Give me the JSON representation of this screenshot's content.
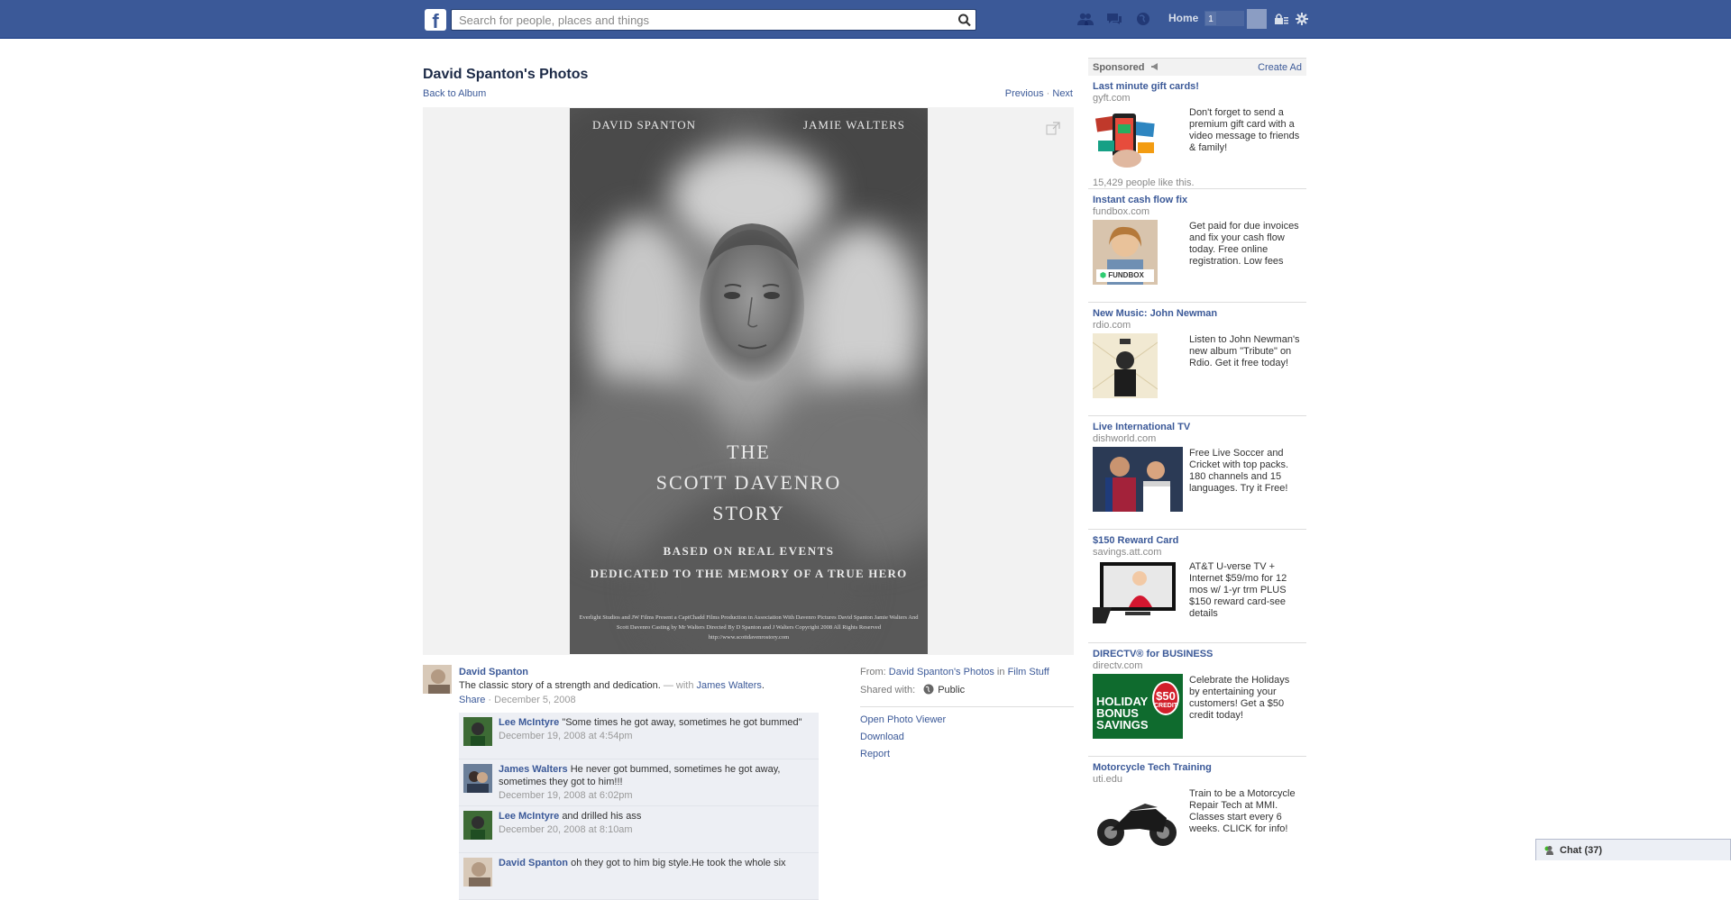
{
  "topbar": {
    "logo": "f",
    "search_placeholder": "Search for people, places and things",
    "home_label": "Home",
    "home_count": "1"
  },
  "page": {
    "title": "David Spanton's Photos",
    "back_link": "Back to Album",
    "previous": "Previous",
    "separator": " · ",
    "next": "Next"
  },
  "poster": {
    "name_left": "DAVID SPANTON",
    "name_right": "JAMIE WALTERS",
    "title": "THE\nSCOTT DAVENRO\nSTORY",
    "subtitle1": "BASED ON REAL EVENTS",
    "subtitle2": "DEDICATED TO THE MEMORY OF A TRUE HERO",
    "credits": "Everlight Studios and JW Films Present a CaptChadd Films Production in Association With Davenro Pictures David Spanton Jamie Walters And Scott Davenro Casting by Mr Walters Directed By D Spanton and J Walters Copyright 2008 All Rights Reserved http://www.scottdavenrostory.com"
  },
  "caption": {
    "owner": "David Spanton",
    "text": "The classic story of a strength and dedication.",
    "with_prefix": " — with ",
    "with_name": "James Walters",
    "with_suffix": ".",
    "share": "Share",
    "date": " · December 5, 2008"
  },
  "comments": [
    {
      "author": "Lee McIntyre",
      "text": "\"Some times he got away, sometimes he got bummed\"",
      "date": "December 19, 2008 at 4:54pm"
    },
    {
      "author": "James Walters",
      "text": "He never got bummed, sometimes he got away, sometimes they got to him!!!",
      "date": "December 19, 2008 at 6:02pm"
    },
    {
      "author": "Lee McIntyre",
      "text": "and drilled his ass",
      "date": "December 20, 2008 at 8:10am"
    },
    {
      "author": "David Spanton",
      "text": "oh they got to him big style.He took the whole six",
      "date": ""
    }
  ],
  "photo_info": {
    "from_label": "From:",
    "from_album": "David Spanton's Photos",
    "in": " in ",
    "from_folder": "Film Stuff",
    "shared_label": "Shared with:",
    "shared_value": "Public"
  },
  "photo_actions": {
    "open_viewer": "Open Photo Viewer",
    "download": "Download",
    "report": "Report"
  },
  "sidebar": {
    "sponsored": "Sponsored",
    "create_ad": "Create Ad",
    "ads": [
      {
        "title": "Last minute gift cards!",
        "domain": "gyft.com",
        "body": "Don't forget to send a premium gift card with a video message to friends & family!",
        "likes": "15,429 people like this."
      },
      {
        "title": "Instant cash flow fix",
        "domain": "fundbox.com",
        "body": "Get paid for due invoices and fix your cash flow today. Free online registration. Low fees",
        "badge": "FUNDBOX"
      },
      {
        "title": "New Music: John Newman",
        "domain": "rdio.com",
        "body": "Listen to John Newman's new album \"Tribute\" on Rdio. Get it free today!"
      },
      {
        "title": "Live International TV",
        "domain": "dishworld.com",
        "body": "Free Live Soccer and Cricket with top packs. 180 channels and 15 languages. Try it Free!"
      },
      {
        "title": "$150 Reward Card",
        "domain": "savings.att.com",
        "body": "AT&T U-verse TV + Internet $59/mo for 12 mos w/ 1-yr trm PLUS $150 reward card-see details"
      },
      {
        "title": "DIRECTV® for BUSINESS",
        "domain": "directv.com",
        "body": "Celebrate the Holidays by entertaining your customers! Get a $50 credit today!",
        "image_text1": "HOLIDAY",
        "image_text2": "BONUS",
        "image_text3": "SAVINGS",
        "image_amount": "$50",
        "image_credit": "CREDIT"
      },
      {
        "title": "Motorcycle Tech Training",
        "domain": "uti.edu",
        "body": "Train to be a Motorcycle Repair Tech at MMI. Classes start every 6 weeks. CLICK for info!"
      }
    ]
  },
  "chat": {
    "label": "Chat (37)"
  },
  "colors": {
    "brand": "#3b5998",
    "link": "#3b5998",
    "comment_bg": "#edeff4"
  }
}
